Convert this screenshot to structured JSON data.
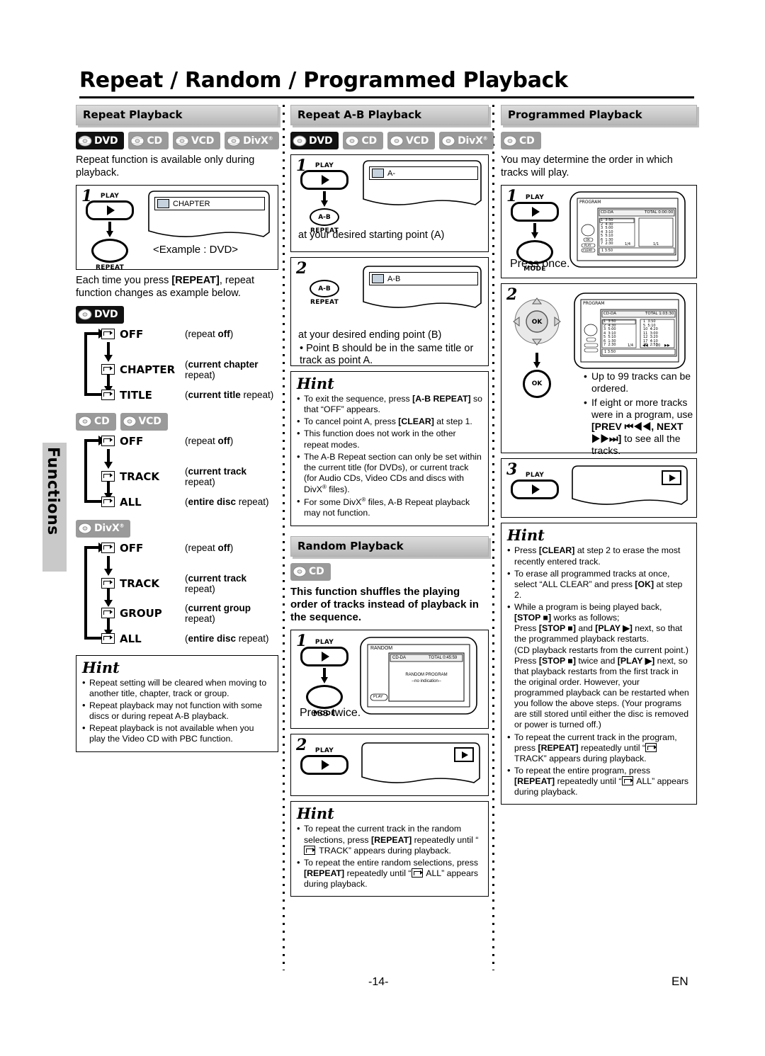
{
  "page": {
    "title": "Repeat / Random / Programmed Playback",
    "side_tab": "Functions",
    "page_number": "-14-",
    "language_code": "EN"
  },
  "icons": {
    "disc": "disc-icon",
    "repeat_osd": "repeat-osd-icon",
    "play_triangle": "play-triangle-icon",
    "arrow_down": "arrow-down-icon"
  },
  "badges": {
    "dvd": "DVD",
    "cd": "CD",
    "vcd": "VCD",
    "divx": "DivX"
  },
  "repeat_playback": {
    "heading": "Repeat Playback",
    "media": [
      "DVD",
      "CD",
      "VCD",
      "DivX"
    ],
    "intro": "Repeat function is available only during playback.",
    "step1": {
      "number": "1",
      "key_label": "PLAY",
      "key2_label": "REPEAT",
      "osd_text": "CHAPTER",
      "caption": "<Example : DVD>"
    },
    "after_text": "Each time you press [REPEAT], repeat function changes as example below.",
    "flows": [
      {
        "media": [
          "DVD"
        ],
        "items": [
          {
            "name": "OFF",
            "desc_pre": "(repeat ",
            "desc_bold": "off",
            "desc_post": ")"
          },
          {
            "name": "CHAPTER",
            "desc_pre": "(",
            "desc_bold": "current chapter",
            "desc_post": " repeat)"
          },
          {
            "name": "TITLE",
            "desc_pre": "(",
            "desc_bold": "current title",
            "desc_post": " repeat)"
          }
        ]
      },
      {
        "media": [
          "CD",
          "VCD"
        ],
        "items": [
          {
            "name": "OFF",
            "desc_pre": "(repeat ",
            "desc_bold": "off",
            "desc_post": ")"
          },
          {
            "name": "TRACK",
            "desc_pre": "(",
            "desc_bold": "current track",
            "desc_post": " repeat)"
          },
          {
            "name": "ALL",
            "desc_pre": "(",
            "desc_bold": "entire disc",
            "desc_post": " repeat)"
          }
        ]
      },
      {
        "media": [
          "DivX"
        ],
        "items": [
          {
            "name": "OFF",
            "desc_pre": "(repeat ",
            "desc_bold": "off",
            "desc_post": ")"
          },
          {
            "name": "TRACK",
            "desc_pre": "(",
            "desc_bold": "current track",
            "desc_post": " repeat)"
          },
          {
            "name": "GROUP",
            "desc_pre": "(",
            "desc_bold": "current group",
            "desc_post": " repeat)"
          },
          {
            "name": "ALL",
            "desc_pre": "(",
            "desc_bold": "entire disc",
            "desc_post": " repeat)"
          }
        ]
      }
    ],
    "hint": {
      "title": "Hint",
      "items": [
        "Repeat setting will be cleared when moving to another title, chapter, track or group.",
        "Repeat playback may not function with some discs or during repeat A-B playback.",
        "Repeat playback is not available when you play the Video CD with PBC function."
      ]
    }
  },
  "repeat_ab": {
    "heading": "Repeat A-B Playback",
    "media": [
      "DVD",
      "CD",
      "VCD",
      "DivX"
    ],
    "step1": {
      "number": "1",
      "key_label": "PLAY",
      "key2_line1": "A-B",
      "key2_line2": "REPEAT",
      "osd_text": "A-",
      "caption": "at your desired starting point (A)"
    },
    "step2": {
      "number": "2",
      "key_line1": "A-B",
      "key_line2": "REPEAT",
      "osd_text": "A-B",
      "caption": "at your desired ending point (B)",
      "bullet": "Point B should be in the same title or track as point A."
    },
    "hint": {
      "title": "Hint",
      "items": [
        "To exit the sequence, press [A-B REPEAT] so that “OFF” appears.",
        "To cancel point A, press [CLEAR] at step 1.",
        "This function does not work in the other repeat modes.",
        "The A-B Repeat section can only be set within the current title (for DVDs), or current track (for Audio CDs, Video CDs and discs with DivX® files).",
        "For some DivX® files, A-B Repeat playback may not function."
      ]
    }
  },
  "random_playback": {
    "heading": "Random Playback",
    "media": [
      "CD"
    ],
    "intro": "This function shuffles the playing order of tracks instead of playback in the sequence.",
    "step1": {
      "number": "1",
      "key_label": "PLAY",
      "key2_label": "MODE",
      "caption": "Press twice.",
      "screen": {
        "title": "RANDOM",
        "disc_type": "CD-DA",
        "total": "TOTAL 0:45:59",
        "line1": "RANDOM PROGRAM",
        "line2": "--no indication--",
        "status": "PLAY"
      }
    },
    "step2": {
      "number": "2",
      "key_label": "PLAY"
    },
    "hint": {
      "title": "Hint",
      "items": [
        "To repeat the current track in the random selections, press [REPEAT] repeatedly until “  TRACK” appears during playback.",
        "To repeat the entire random selections, press [REPEAT] repeatedly until “  ALL” appears during playback."
      ]
    }
  },
  "programmed_playback": {
    "heading": "Programmed Playback",
    "media": [
      "CD"
    ],
    "intro": "You may determine the order in which tracks will play.",
    "step1": {
      "number": "1",
      "key_label": "PLAY",
      "key2_label": "MODE",
      "caption": "Press once.",
      "screen": {
        "title": "PROGRAM",
        "disc_type": "CD-DA",
        "total": "TOTAL 0:00:00",
        "tracks": [
          {
            "no": "1",
            "time": "3:50"
          },
          {
            "no": "2",
            "time": "4:30"
          },
          {
            "no": "3",
            "time": "5:00"
          },
          {
            "no": "4",
            "time": "3:10"
          },
          {
            "no": "5",
            "time": "5:10"
          },
          {
            "no": "6",
            "time": "1:30"
          },
          {
            "no": "7",
            "time": "2:30"
          }
        ],
        "page_left": "1/4",
        "page_right": "1/1",
        "footer": "1  3:50",
        "btn_ok": "OK",
        "btn_play": "PLAY",
        "btn_clear": "CLEAR"
      }
    },
    "step2": {
      "number": "2",
      "key_label": "OK",
      "screen": {
        "title": "PROGRAM",
        "disc_type": "CD-DA",
        "total": "TOTAL 1:03:30",
        "tracks": [
          {
            "no": "1",
            "time": "3:50"
          },
          {
            "no": "2",
            "time": "4:30"
          },
          {
            "no": "3",
            "time": "5:00"
          },
          {
            "no": "4",
            "time": "3:10"
          },
          {
            "no": "5",
            "time": "5:10"
          },
          {
            "no": "6",
            "time": "1:30"
          },
          {
            "no": "7",
            "time": "2:30"
          }
        ],
        "program": [
          {
            "no": "1",
            "time": "3:50"
          },
          {
            "no": "5",
            "time": "5:10"
          },
          {
            "no": "10",
            "time": "4:20"
          },
          {
            "no": "11",
            "time": "3:00"
          },
          {
            "no": "12",
            "time": "3:20"
          },
          {
            "no": "17",
            "time": "4:10"
          },
          {
            "no": "20",
            "time": "2:50"
          }
        ],
        "page_left": "1/4",
        "prev": "◀◀",
        "page_right": "20",
        "next": "▶▶",
        "footer": "1  3:50"
      },
      "bullets": [
        {
          "pre": "Up to 99 tracks can be ordered.",
          "bold": "",
          "post": ""
        },
        {
          "pre": "If eight or more tracks were in a program, use ",
          "bold": "[PREV ⏮◀◀, NEXT ▶▶⏭]",
          "post": " to see all the tracks."
        }
      ]
    },
    "step3": {
      "number": "3",
      "key_label": "PLAY"
    },
    "hint": {
      "title": "Hint",
      "items": [
        "Press [CLEAR] at step 2 to erase the most recently entered track.",
        "To erase all programmed tracks at once, select “ALL CLEAR” and press [OK] at step 2.",
        "While a program is being played back, [STOP ■] works as follows; Press [STOP ■] and [PLAY ▶] next, so that the programmed playback restarts. (CD playback restarts from the current point.) Press [STOP ■] twice and [PLAY ▶] next, so that playback restarts from the first track in the original order. However, your programmed playback can be restarted when you follow the above steps. (Your programs are still stored until either the disc is removed or power is turned off.)",
        "To repeat the current track in the program, press [REPEAT] repeatedly until “  TRACK” appears during playback.",
        "To repeat the entire program, press [REPEAT] repeatedly until “  ALL” appears during playback."
      ]
    }
  }
}
